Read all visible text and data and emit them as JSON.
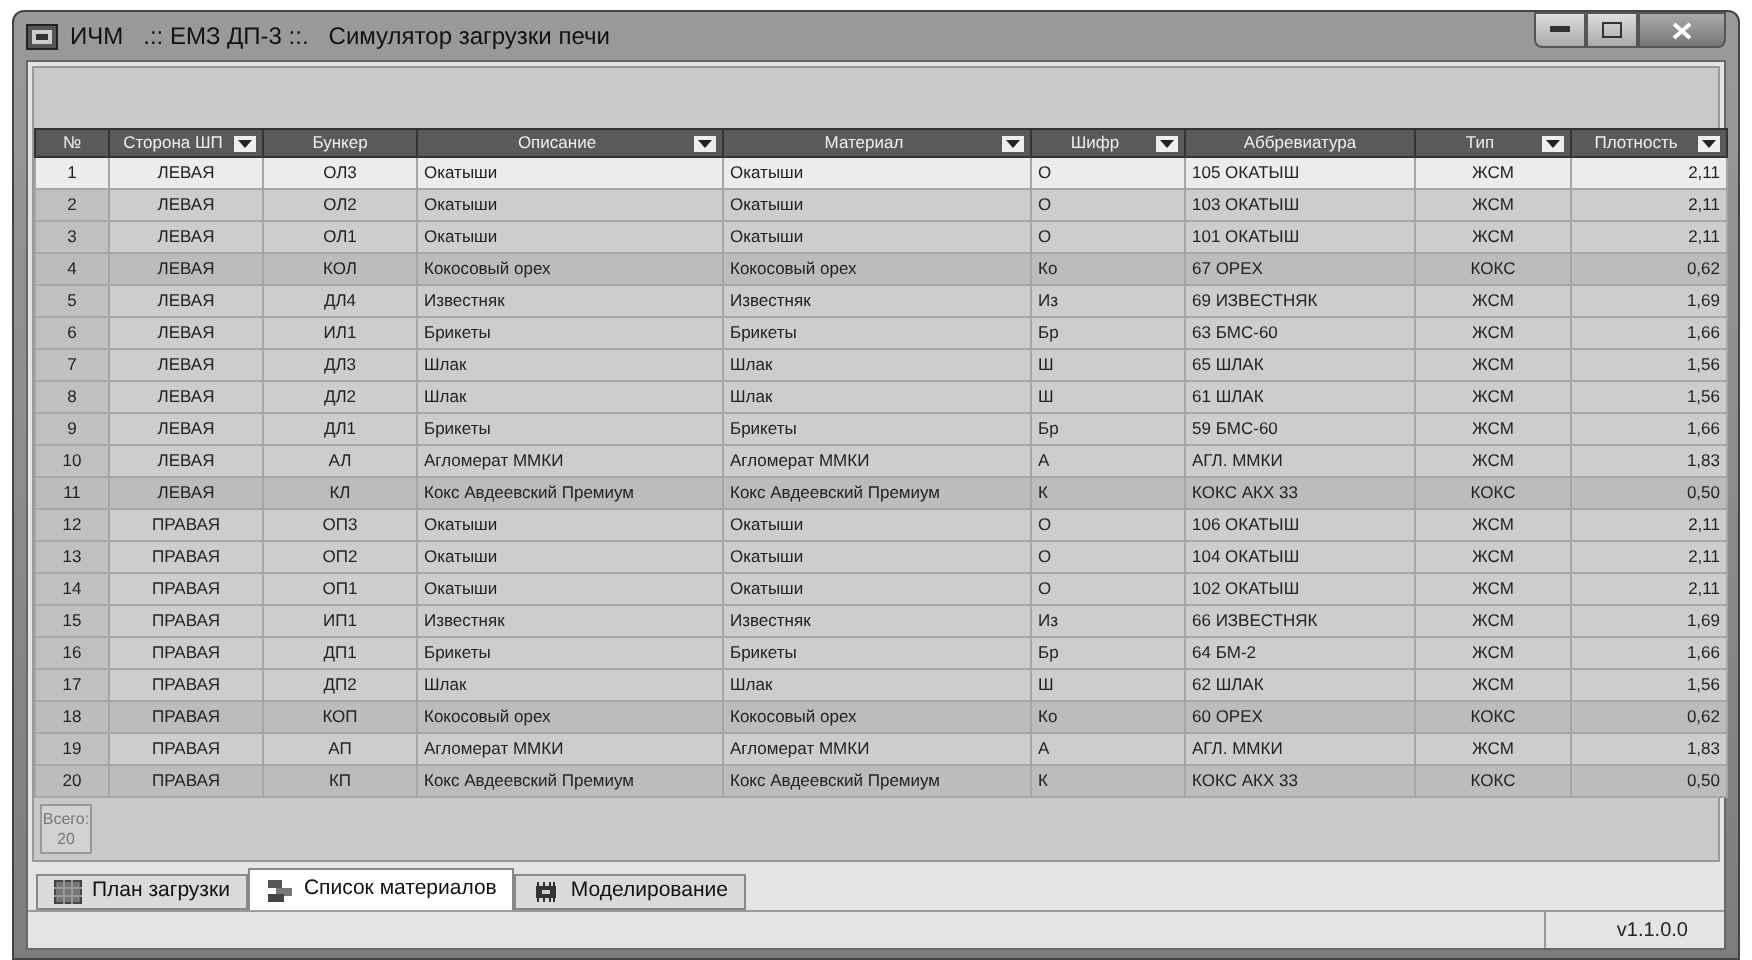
{
  "window": {
    "title": "ИЧМ   .:: ЕМЗ ДП-3 ::.   Симулятор загрузки печи"
  },
  "table": {
    "columns": [
      {
        "label": "№",
        "filter": false
      },
      {
        "label": "Сторона ШП",
        "filter": true
      },
      {
        "label": "Бункер",
        "filter": false
      },
      {
        "label": "Описание",
        "filter": true
      },
      {
        "label": "Материал",
        "filter": true
      },
      {
        "label": "Шифр",
        "filter": true
      },
      {
        "label": "Аббревиатура",
        "filter": false
      },
      {
        "label": "Тип",
        "filter": true
      },
      {
        "label": "Плотность",
        "filter": true
      }
    ],
    "rows": [
      {
        "selected": true,
        "shaded": false,
        "cells": [
          "1",
          "ЛЕВАЯ",
          "ОЛ3",
          "Окатыши",
          "Окатыши",
          "О",
          "105 ОКАТЫШ",
          "ЖСМ",
          "2,11"
        ]
      },
      {
        "selected": false,
        "shaded": false,
        "cells": [
          "2",
          "ЛЕВАЯ",
          "ОЛ2",
          "Окатыши",
          "Окатыши",
          "О",
          "103 ОКАТЫШ",
          "ЖСМ",
          "2,11"
        ]
      },
      {
        "selected": false,
        "shaded": false,
        "cells": [
          "3",
          "ЛЕВАЯ",
          "ОЛ1",
          "Окатыши",
          "Окатыши",
          "О",
          "101 ОКАТЫШ",
          "ЖСМ",
          "2,11"
        ]
      },
      {
        "selected": false,
        "shaded": true,
        "cells": [
          "4",
          "ЛЕВАЯ",
          "КОЛ",
          "Кокосовый орех",
          "Кокосовый орех",
          "Ко",
          "67 ОРЕХ",
          "КОКС",
          "0,62"
        ]
      },
      {
        "selected": false,
        "shaded": false,
        "cells": [
          "5",
          "ЛЕВАЯ",
          "ДЛ4",
          "Известняк",
          "Известняк",
          "Из",
          "69 ИЗВЕСТНЯК",
          "ЖСМ",
          "1,69"
        ]
      },
      {
        "selected": false,
        "shaded": false,
        "cells": [
          "6",
          "ЛЕВАЯ",
          "ИЛ1",
          "Брикеты",
          "Брикеты",
          "Бр",
          "63 БМС-60",
          "ЖСМ",
          "1,66"
        ]
      },
      {
        "selected": false,
        "shaded": false,
        "cells": [
          "7",
          "ЛЕВАЯ",
          "ДЛ3",
          "Шлак",
          "Шлак",
          "Ш",
          "65 ШЛАК",
          "ЖСМ",
          "1,56"
        ]
      },
      {
        "selected": false,
        "shaded": false,
        "cells": [
          "8",
          "ЛЕВАЯ",
          "ДЛ2",
          "Шлак",
          "Шлак",
          "Ш",
          "61 ШЛАК",
          "ЖСМ",
          "1,56"
        ]
      },
      {
        "selected": false,
        "shaded": false,
        "cells": [
          "9",
          "ЛЕВАЯ",
          "ДЛ1",
          "Брикеты",
          "Брикеты",
          "Бр",
          "59 БМС-60",
          "ЖСМ",
          "1,66"
        ]
      },
      {
        "selected": false,
        "shaded": false,
        "cells": [
          "10",
          "ЛЕВАЯ",
          "АЛ",
          "Агломерат ММКИ",
          "Агломерат ММКИ",
          "А",
          "АГЛ. ММКИ",
          "ЖСМ",
          "1,83"
        ]
      },
      {
        "selected": false,
        "shaded": true,
        "cells": [
          "11",
          "ЛЕВАЯ",
          "КЛ",
          "Кокс Авдеевский Премиум",
          "Кокс Авдеевский Премиум",
          "К",
          "КОКС АКХ 33",
          "КОКС",
          "0,50"
        ]
      },
      {
        "selected": false,
        "shaded": false,
        "cells": [
          "12",
          "ПРАВАЯ",
          "ОП3",
          "Окатыши",
          "Окатыши",
          "О",
          "106 ОКАТЫШ",
          "ЖСМ",
          "2,11"
        ]
      },
      {
        "selected": false,
        "shaded": false,
        "cells": [
          "13",
          "ПРАВАЯ",
          "ОП2",
          "Окатыши",
          "Окатыши",
          "О",
          "104 ОКАТЫШ",
          "ЖСМ",
          "2,11"
        ]
      },
      {
        "selected": false,
        "shaded": false,
        "cells": [
          "14",
          "ПРАВАЯ",
          "ОП1",
          "Окатыши",
          "Окатыши",
          "О",
          "102 ОКАТЫШ",
          "ЖСМ",
          "2,11"
        ]
      },
      {
        "selected": false,
        "shaded": false,
        "cells": [
          "15",
          "ПРАВАЯ",
          "ИП1",
          "Известняк",
          "Известняк",
          "Из",
          "66 ИЗВЕСТНЯК",
          "ЖСМ",
          "1,69"
        ]
      },
      {
        "selected": false,
        "shaded": false,
        "cells": [
          "16",
          "ПРАВАЯ",
          "ДП1",
          "Брикеты",
          "Брикеты",
          "Бр",
          "64 БМ-2",
          "ЖСМ",
          "1,66"
        ]
      },
      {
        "selected": false,
        "shaded": false,
        "cells": [
          "17",
          "ПРАВАЯ",
          "ДП2",
          "Шлак",
          "Шлак",
          "Ш",
          "62 ШЛАК",
          "ЖСМ",
          "1,56"
        ]
      },
      {
        "selected": false,
        "shaded": true,
        "cells": [
          "18",
          "ПРАВАЯ",
          "КОП",
          "Кокосовый орех",
          "Кокосовый орех",
          "Ко",
          "60 ОРЕХ",
          "КОКС",
          "0,62"
        ]
      },
      {
        "selected": false,
        "shaded": false,
        "cells": [
          "19",
          "ПРАВАЯ",
          "АП",
          "Агломерат ММКИ",
          "Агломерат ММКИ",
          "А",
          "АГЛ. ММКИ",
          "ЖСМ",
          "1,83"
        ]
      },
      {
        "selected": false,
        "shaded": true,
        "cells": [
          "20",
          "ПРАВАЯ",
          "КП",
          "Кокс Авдеевский Премиум",
          "Кокс Авдеевский Премиум",
          "К",
          "КОКС АКХ 33",
          "КОКС",
          "0,50"
        ]
      }
    ],
    "total": {
      "label": "Всего:",
      "value": "20"
    }
  },
  "tabs": [
    {
      "label": "План загрузки",
      "selected": false
    },
    {
      "label": "Список материалов",
      "selected": true
    },
    {
      "label": "Моделирование",
      "selected": false
    }
  ],
  "status_bar": {
    "version": "v1.1.0.0"
  }
}
